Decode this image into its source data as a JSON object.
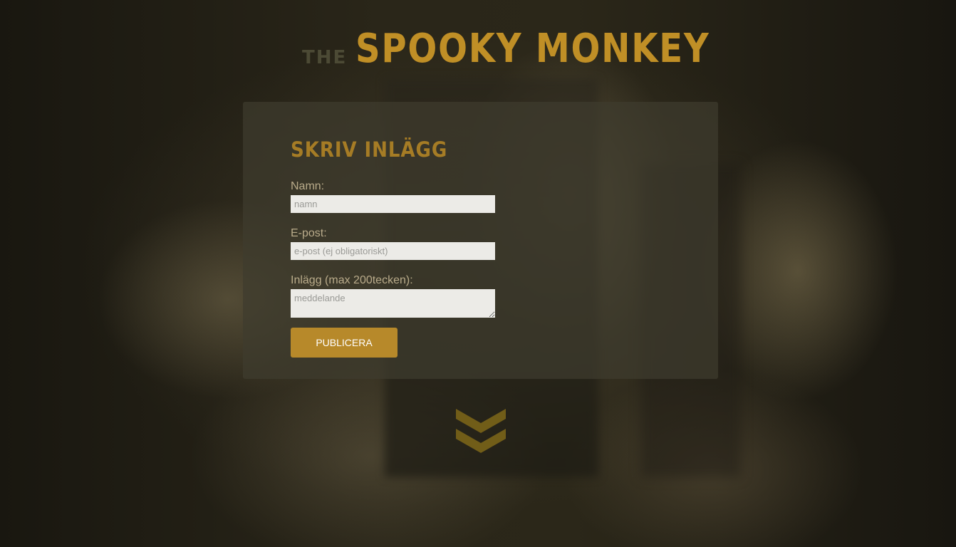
{
  "logo": {
    "the": "the",
    "name": "Spooky Monkey"
  },
  "form": {
    "title": "Skriv inlägg",
    "name_label": "Namn:",
    "name_placeholder": "namn",
    "email_label": "E-post:",
    "email_placeholder": "e-post (ej obligatoriskt)",
    "message_label": "Inlägg (max 200tecken):",
    "message_placeholder": "meddelande",
    "submit_label": "Publicera"
  },
  "icons": {
    "scroll_down": "double-chevron-down-icon"
  },
  "colors": {
    "accent": "#b7892a",
    "logo": "#c08f26",
    "title": "#a67c25",
    "label": "#b9ab8a",
    "panel": "#3e3c2e",
    "chevron": "#7a6418"
  }
}
